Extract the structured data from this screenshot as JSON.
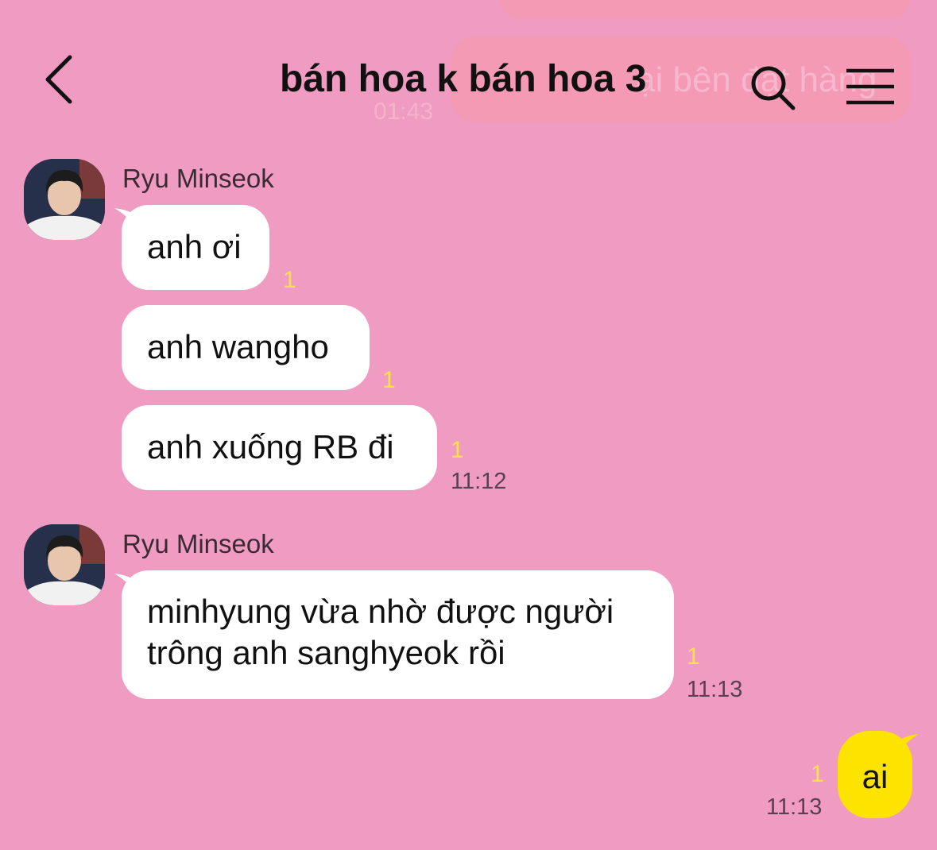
{
  "header": {
    "title": "bán hoa k bán hoa 3"
  },
  "background_overlay": {
    "message_fragment": "ại bên      đặt hàng",
    "time": "01:43"
  },
  "messages": [
    {
      "sender": "Ryu Minseok",
      "bubbles": [
        {
          "text": "anh ơi",
          "unread": "1"
        },
        {
          "text": "anh wangho",
          "unread": "1"
        },
        {
          "text": "anh xuống RB đi",
          "unread": "1",
          "time": "11:12"
        }
      ]
    },
    {
      "sender": "Ryu Minseok",
      "bubbles": [
        {
          "line1": "minhyung vừa nhờ được người",
          "line2": "trông anh sanghyeok rồi",
          "unread": "1",
          "time": "11:13"
        }
      ]
    },
    {
      "sender": "me",
      "bubbles": [
        {
          "text": "ai",
          "unread": "1",
          "time": "11:13"
        }
      ]
    }
  ],
  "colors": {
    "background": "#f09bc2",
    "incoming_bubble": "#ffffff",
    "outgoing_bubble": "#fde400",
    "unread_count": "#ffe24a"
  }
}
